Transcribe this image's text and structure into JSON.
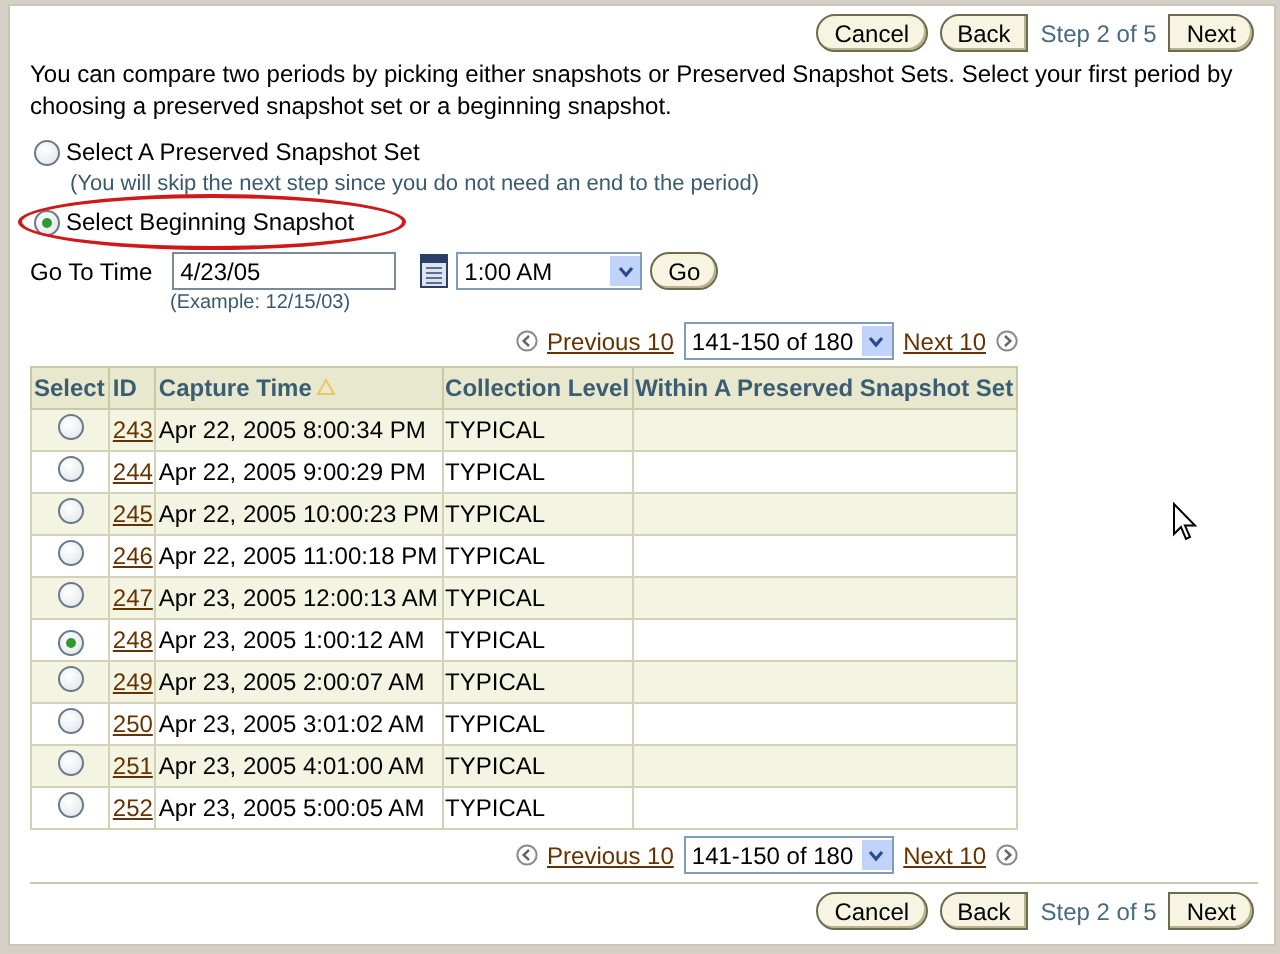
{
  "top_nav": {
    "cancel": "Cancel",
    "back": "Back",
    "step": "Step 2 of 5",
    "next": "Next"
  },
  "intro": "You can compare two periods by picking either snapshots or Preserved Snapshot Sets. Select your first period by choosing a preserved snapshot set or a beginning snapshot.",
  "options": [
    {
      "label": "Select A Preserved Snapshot Set",
      "selected": false,
      "highlighted": false,
      "note": "(You will skip the next step since you do not need an end to the period)"
    },
    {
      "label": "Select Beginning Snapshot",
      "selected": true,
      "highlighted": true
    }
  ],
  "go_to_time": {
    "label": "Go To Time",
    "value": "4/23/05",
    "hint": "(Example: 12/15/03)",
    "time": "1:00 AM",
    "button": "Go"
  },
  "pager_top": {
    "previous": "Previous 10",
    "range": "141-150 of 180",
    "next": "Next 10"
  },
  "table": {
    "columns": [
      {
        "label": "Select",
        "sorted": false
      },
      {
        "label": "ID",
        "sorted": false
      },
      {
        "label": "Capture Time",
        "sorted": true
      },
      {
        "label": "Collection Level",
        "sorted": false
      },
      {
        "label": "Within A Preserved Snapshot Set",
        "sorted": false
      }
    ],
    "rows": [
      {
        "selected": false,
        "id": "243",
        "capture_time": "Apr 22, 2005 8:00:34 PM",
        "collection_level": "TYPICAL"
      },
      {
        "selected": false,
        "id": "244",
        "capture_time": "Apr 22, 2005 9:00:29 PM",
        "collection_level": "TYPICAL"
      },
      {
        "selected": false,
        "id": "245",
        "capture_time": "Apr 22, 2005 10:00:23 PM",
        "collection_level": "TYPICAL"
      },
      {
        "selected": false,
        "id": "246",
        "capture_time": "Apr 22, 2005 11:00:18 PM",
        "collection_level": "TYPICAL"
      },
      {
        "selected": false,
        "id": "247",
        "capture_time": "Apr 23, 2005 12:00:13 AM",
        "collection_level": "TYPICAL"
      },
      {
        "selected": true,
        "id": "248",
        "capture_time": "Apr 23, 2005 1:00:12 AM",
        "collection_level": "TYPICAL"
      },
      {
        "selected": false,
        "id": "249",
        "capture_time": "Apr 23, 2005 2:00:07 AM",
        "collection_level": "TYPICAL"
      },
      {
        "selected": false,
        "id": "250",
        "capture_time": "Apr 23, 2005 3:01:02 AM",
        "collection_level": "TYPICAL"
      },
      {
        "selected": false,
        "id": "251",
        "capture_time": "Apr 23, 2005 4:01:00 AM",
        "collection_level": "TYPICAL"
      },
      {
        "selected": false,
        "id": "252",
        "capture_time": "Apr 23, 2005 5:00:05 AM",
        "collection_level": "TYPICAL"
      }
    ]
  },
  "pager_bottom": {
    "previous": "Previous 10",
    "range": "141-150 of 180",
    "next": "Next 10"
  },
  "bottom_nav": {
    "cancel": "Cancel",
    "back": "Back",
    "step": "Step 2 of 5",
    "next": "Next"
  }
}
